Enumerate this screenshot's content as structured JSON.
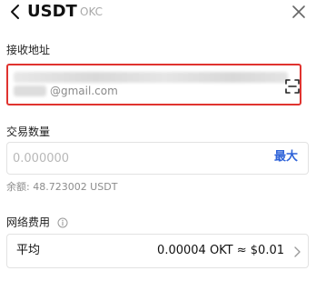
{
  "header": {
    "title": "USDT",
    "network": "OKC",
    "back_icon": "chevron-left-icon",
    "close_icon": "close-icon"
  },
  "recipient": {
    "label": "接收地址",
    "address_visible_suffix": "@gmail.com",
    "scan_icon": "scan-icon"
  },
  "amount": {
    "label": "交易数量",
    "placeholder": "0.000000",
    "value": "",
    "max_label": "最大"
  },
  "balance": {
    "text": "余额: 48.723002 USDT"
  },
  "fee": {
    "label": "网络费用",
    "info_icon": "info-icon",
    "speed": "平均",
    "value": "0.00004 OKT ≈ $0.01",
    "chevron_icon": "chevron-right-icon"
  },
  "colors": {
    "highlight_border": "#e0332f",
    "accent": "#2f63d8",
    "muted_text": "#8c8c8c",
    "border": "#e2e2e2"
  }
}
